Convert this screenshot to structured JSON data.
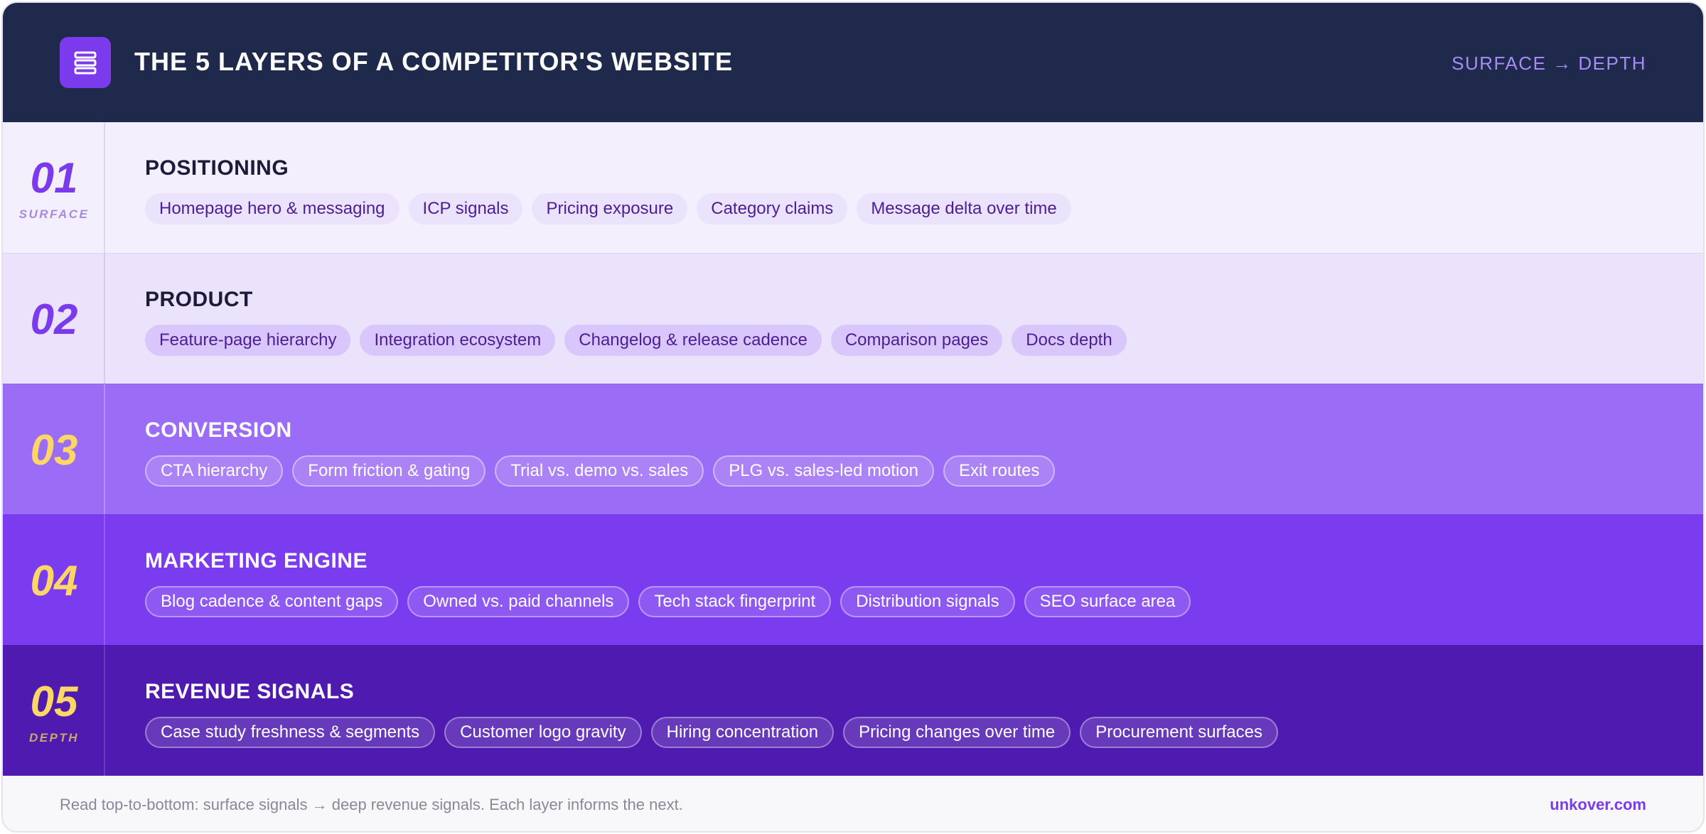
{
  "header": {
    "title": "THE 5 LAYERS OF A COMPETITOR'S WEBSITE",
    "direction_label": "SURFACE → DEPTH",
    "icon": "layers-stack-icon",
    "accent_color": "#7c3aed",
    "background_color": "#1e294b"
  },
  "layers": [
    {
      "number": "01",
      "tag": "SURFACE",
      "title": "POSITIONING",
      "color": "#f3effd",
      "chips": [
        "Homepage hero & messaging",
        "ICP signals",
        "Pricing exposure",
        "Category claims",
        "Message delta over time"
      ]
    },
    {
      "number": "02",
      "tag": "",
      "title": "PRODUCT",
      "color": "#ebe2fc",
      "chips": [
        "Feature-page hierarchy",
        "Integration ecosystem",
        "Changelog & release cadence",
        "Comparison pages",
        "Docs depth"
      ]
    },
    {
      "number": "03",
      "tag": "",
      "title": "CONVERSION",
      "color": "#9b6cf5",
      "chips": [
        "CTA hierarchy",
        "Form friction & gating",
        "Trial vs. demo vs. sales",
        "PLG vs. sales-led motion",
        "Exit routes"
      ]
    },
    {
      "number": "04",
      "tag": "",
      "title": "MARKETING ENGINE",
      "color": "#7b3cf0",
      "chips": [
        "Blog cadence & content gaps",
        "Owned vs. paid channels",
        "Tech stack fingerprint",
        "Distribution signals",
        "SEO surface area"
      ]
    },
    {
      "number": "05",
      "tag": "DEPTH",
      "title": "REVENUE SIGNALS",
      "color": "#4f1ab0",
      "chips": [
        "Case study freshness & segments",
        "Customer logo gravity",
        "Hiring concentration",
        "Pricing changes over time",
        "Procurement surfaces"
      ]
    }
  ],
  "footer": {
    "note": "Read top-to-bottom: surface signals → deep revenue signals. Each layer informs the next.",
    "brand": "unkover.com"
  }
}
